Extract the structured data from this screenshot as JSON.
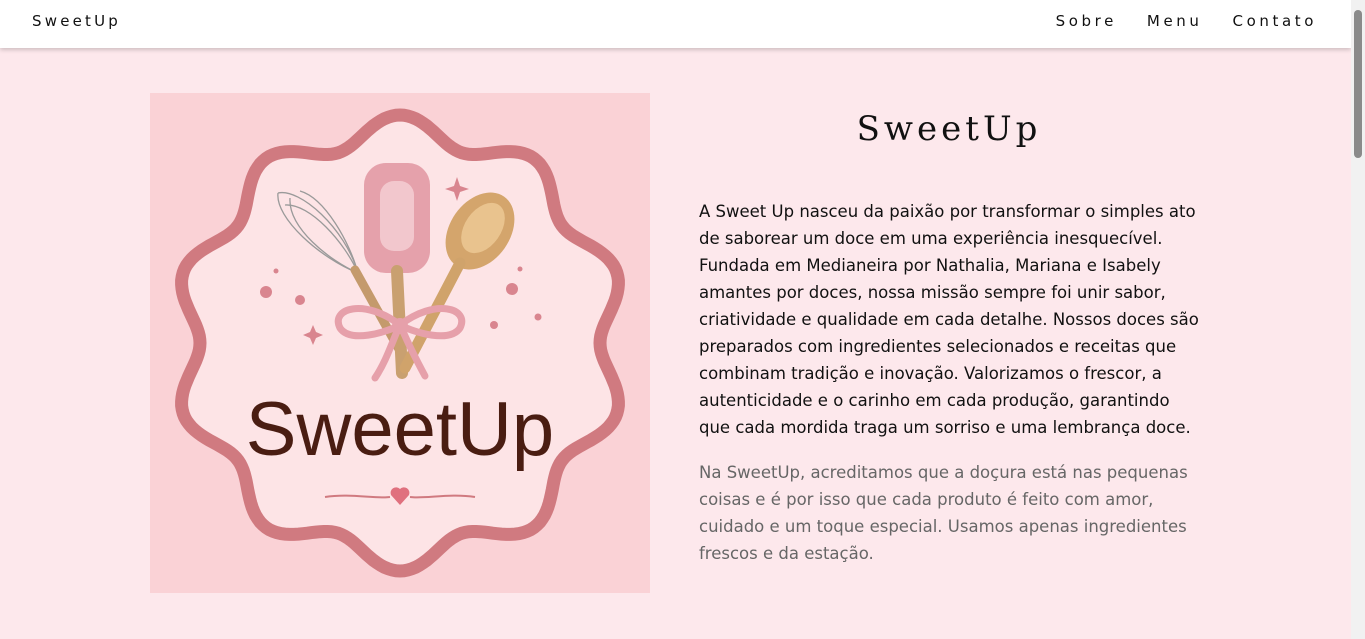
{
  "nav": {
    "brand": "SweetUp",
    "links": [
      "Sobre",
      "Menu",
      "Contato"
    ]
  },
  "hero": {
    "logo_text": "SweetUp",
    "title": "SweetUp",
    "paragraph1": "A Sweet Up nasceu da paixão por transformar o simples ato de saborear um doce em uma experiência inesquecível. Fundada em Medianeira por Nathalia, Mariana e Isabely amantes por doces, nossa missão sempre foi unir sabor, criatividade e qualidade em cada detalhe. Nossos doces são preparados com ingredientes selecionados e receitas que combinam tradição e inovação. Valorizamos o frescor, a autenticidade e o carinho em cada produção, garantindo que cada mordida traga um sorriso e uma lembrança doce.",
    "paragraph2": "Na SweetUp, acreditamos que a doçura está nas pequenas coisas e é por isso que cada produto é feito com amor, cuidado e um toque especial. Usamos apenas ingredientes frescos e da estação."
  },
  "colors": {
    "page_background": "#fde8ec",
    "logo_background": "#fad2d6",
    "logo_border": "#d07a80",
    "logo_text": "#4a1d12"
  }
}
